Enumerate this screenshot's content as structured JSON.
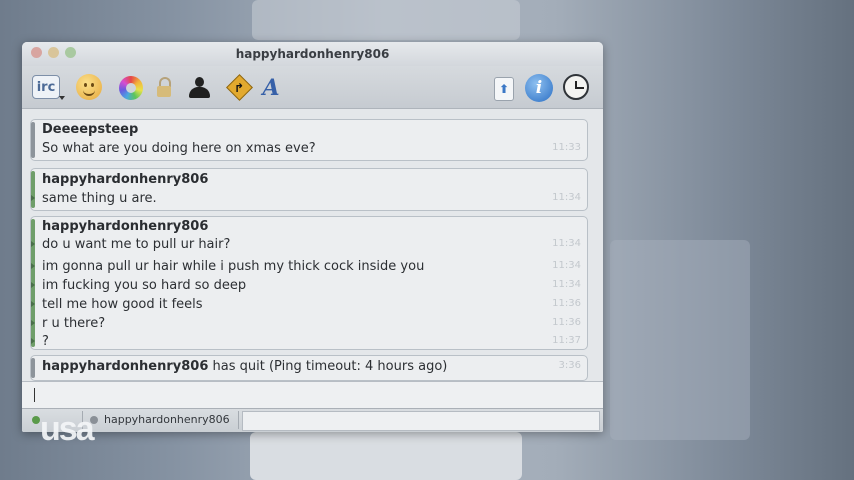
{
  "window": {
    "title": "happyhardonhenry806"
  },
  "toolbar": {
    "irc_label": "irc",
    "font_label": "A",
    "info_label": "i",
    "upload_label": "⬆"
  },
  "messages": [
    {
      "sender": "Deeeepsteep",
      "lines": [
        {
          "text": "So what are you doing here on xmas eve?",
          "time": "11:33"
        }
      ]
    },
    {
      "sender": "happyhardonhenry806",
      "lines": [
        {
          "text": "same thing u are.",
          "time": "11:34"
        }
      ]
    },
    {
      "sender": "happyhardonhenry806",
      "lines": [
        {
          "text": "do u want me to pull ur hair?",
          "time": "11:34"
        },
        {
          "text": "im gonna pull ur hair while i push my thick cock inside you",
          "time": "11:34"
        },
        {
          "text": "im fucking you so hard so deep",
          "time": "11:34"
        },
        {
          "text": "tell me how good it feels",
          "time": "11:36"
        },
        {
          "text": "r u there?",
          "time": "11:36"
        },
        {
          "text": "?",
          "time": "11:37"
        }
      ]
    }
  ],
  "quit_notice": {
    "name": "happyhardonhenry806",
    "text": "has quit (Ping timeout: 4 hours ago)",
    "time": "3:36"
  },
  "tabs": [
    {
      "label": ""
    },
    {
      "label": "happyhardonhenry806"
    }
  ],
  "watermark": "usa"
}
